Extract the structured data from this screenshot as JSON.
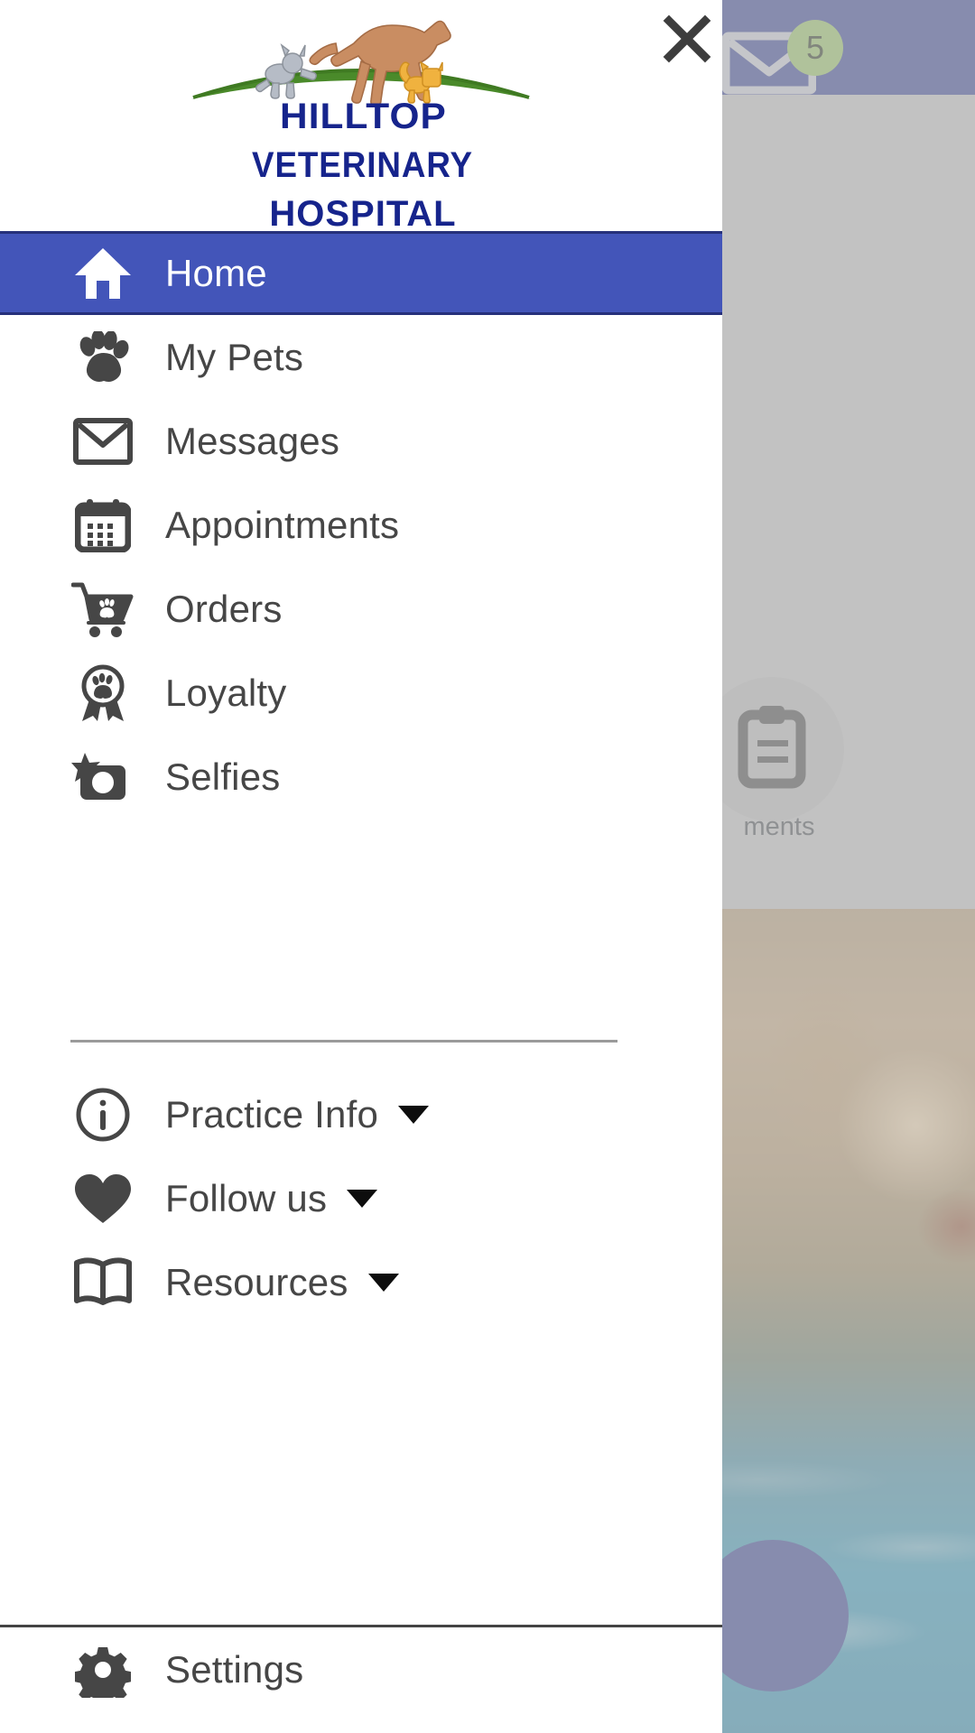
{
  "app": {
    "practice_name_lines": [
      "HILLTOP",
      "VETERINARY",
      "HOSPITAL"
    ],
    "logo_alt": "Hilltop Veterinary Hospital logo",
    "accent_blue": "#4355b9",
    "header_blue": "#2e3a93",
    "badge_green": "#9ac763",
    "icon_gray": "#464646"
  },
  "drawer": {
    "close_label": "Close menu",
    "primary_items": [
      {
        "label": "Home",
        "icon": "home-icon",
        "active": true,
        "has_caret": false
      },
      {
        "label": "My Pets",
        "icon": "paw-icon",
        "active": false,
        "has_caret": false
      },
      {
        "label": "Messages",
        "icon": "envelope-icon",
        "active": false,
        "has_caret": false
      },
      {
        "label": "Appointments",
        "icon": "calendar-icon",
        "active": false,
        "has_caret": false
      },
      {
        "label": "Orders",
        "icon": "cart-paw-icon",
        "active": false,
        "has_caret": false
      },
      {
        "label": "Loyalty",
        "icon": "award-paw-icon",
        "active": false,
        "has_caret": false
      },
      {
        "label": "Selfies",
        "icon": "camera-star-icon",
        "active": false,
        "has_caret": false
      }
    ],
    "secondary_items": [
      {
        "label": "Practice Info",
        "icon": "info-circle-icon",
        "active": false,
        "has_caret": true
      },
      {
        "label": "Follow us",
        "icon": "heart-icon",
        "active": false,
        "has_caret": true
      },
      {
        "label": "Resources",
        "icon": "book-icon",
        "active": false,
        "has_caret": true
      }
    ],
    "footer_items": [
      {
        "label": "Settings",
        "icon": "gear-icon",
        "active": false,
        "has_caret": false
      }
    ]
  },
  "background": {
    "mail_icon": "envelope-icon",
    "unread_badge": "5",
    "quick_action_label": "ments",
    "quick_action_icon": "clipboard-icon",
    "fab_icon": "fab-circle"
  }
}
